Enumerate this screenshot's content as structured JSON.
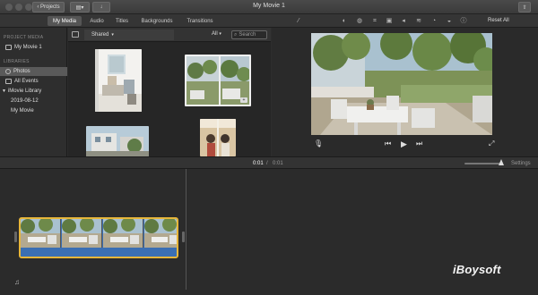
{
  "window": {
    "title": "My Movie 1",
    "projects_button": "Projects"
  },
  "tabs": [
    {
      "label": "My Media",
      "active": true
    },
    {
      "label": "Audio",
      "active": false
    },
    {
      "label": "Titles",
      "active": false
    },
    {
      "label": "Backgrounds",
      "active": false
    },
    {
      "label": "Transitions",
      "active": false
    }
  ],
  "toolbar": {
    "reset_all": "Reset All",
    "tool_icons": [
      "magic-wand-icon",
      "color-balance-icon",
      "color-correction-icon",
      "crop-icon",
      "stabilization-icon",
      "volume-icon",
      "noise-reduction-icon",
      "speed-icon",
      "filter-icon",
      "info-icon"
    ]
  },
  "sidebar": {
    "project_media_header": "PROJECT MEDIA",
    "project_item": "My Movie 1",
    "libraries_header": "LIBRARIES",
    "photos": "Photos",
    "all_events": "All Events",
    "movie_library": "iMovie Library",
    "event_date": "2019-08-12",
    "my_movie": "My Movie"
  },
  "browser": {
    "crumb": "Shared",
    "filter": "All",
    "search_placeholder": "Search"
  },
  "timeline": {
    "timecode_current": "0:01",
    "timecode_separator": "/",
    "timecode_total": "0:01",
    "settings": "Settings"
  },
  "watermark": "iBoysoft",
  "colors": {
    "accent_selection": "#e7b63a",
    "audio_bar": "#3b6fb3"
  }
}
